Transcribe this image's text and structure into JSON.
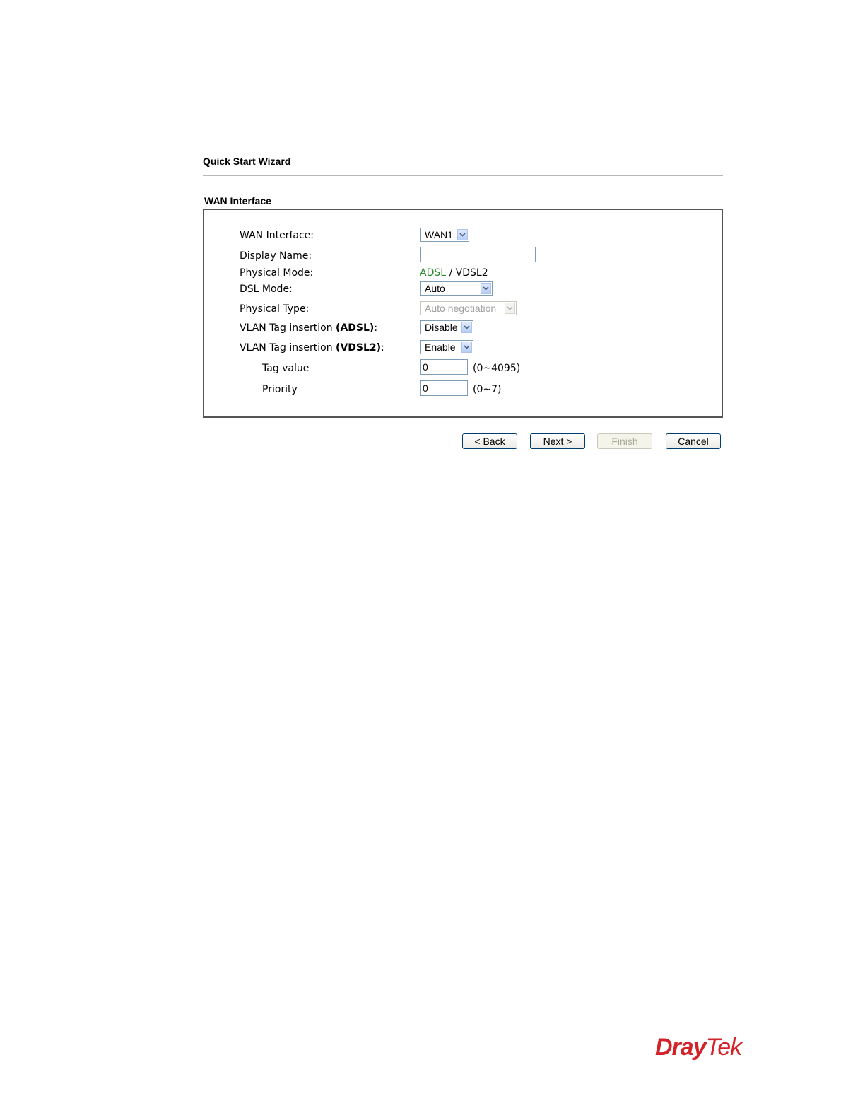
{
  "header": {
    "wizard_title": "Quick Start Wizard",
    "section_title": "WAN Interface"
  },
  "form": {
    "wan_interface": {
      "label": "WAN Interface:",
      "value": "WAN1"
    },
    "display_name": {
      "label": "Display Name:",
      "value": ""
    },
    "physical_mode": {
      "label": "Physical Mode:",
      "adsl": "ADSL",
      "separator": " / ",
      "vdsl2": "VDSL2",
      "active_color": "#2b8a2b"
    },
    "dsl_mode": {
      "label": "DSL Mode:",
      "value": "Auto"
    },
    "physical_type": {
      "label": "Physical Type:",
      "value": "Auto negotiation",
      "disabled": true
    },
    "vlan_adsl": {
      "label_prefix": "VLAN Tag insertion ",
      "label_bold": "(ADSL)",
      "label_suffix": ":",
      "value": "Disable"
    },
    "vlan_vdsl2": {
      "label_prefix": "VLAN Tag insertion ",
      "label_bold": "(VDSL2)",
      "label_suffix": ":",
      "value": "Enable"
    },
    "tag_value": {
      "label": "Tag value",
      "value": "0",
      "range": "(0~4095)"
    },
    "priority": {
      "label": "Priority",
      "value": "0",
      "range": "(0~7)"
    }
  },
  "buttons": {
    "back": "< Back",
    "next": "Next >",
    "finish": "Finish",
    "cancel": "Cancel"
  },
  "logo": {
    "dray": "Dray",
    "tek": "Tek",
    "color": "#d2232a"
  }
}
